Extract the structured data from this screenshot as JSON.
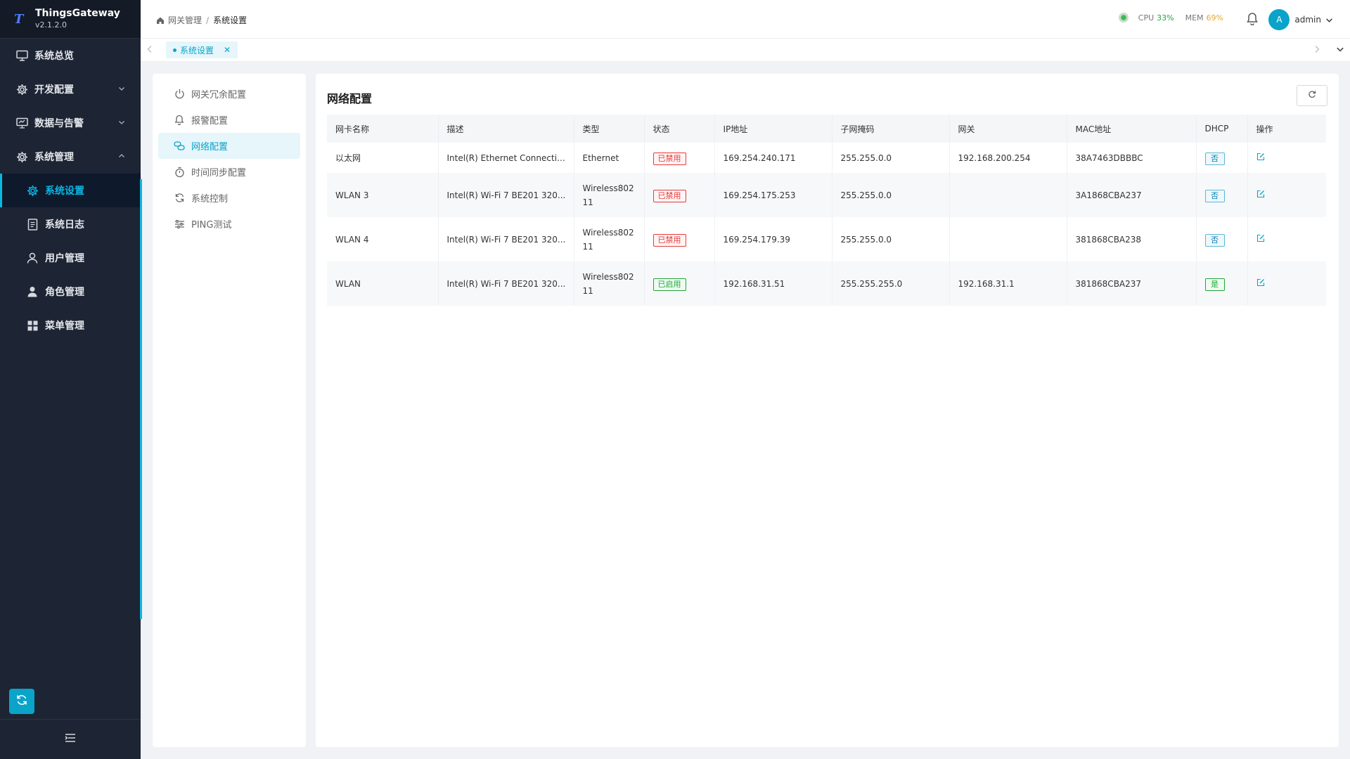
{
  "app": {
    "name": "ThingsGateway",
    "version": "v2.1.2.0"
  },
  "sidebar": {
    "items": [
      {
        "label": "系统总览",
        "icon": "monitor-icon"
      },
      {
        "label": "开发配置",
        "icon": "gear-icon"
      },
      {
        "label": "数据与告警",
        "icon": "monitor-icon"
      },
      {
        "label": "系统管理",
        "icon": "gear-icon"
      },
      {
        "label": "系统设置",
        "icon": "gear-icon"
      },
      {
        "label": "系统日志",
        "icon": "document-icon"
      },
      {
        "label": "用户管理",
        "icon": "user-icon"
      },
      {
        "label": "角色管理",
        "icon": "user-solid-icon"
      },
      {
        "label": "菜单管理",
        "icon": "grid-icon"
      }
    ]
  },
  "header": {
    "breadcrumb": [
      "网关管理",
      "系统设置"
    ],
    "cpu_label": "CPU",
    "cpu_value": "33%",
    "mem_label": "MEM",
    "mem_value": "69%",
    "avatar_letter": "A",
    "username": "admin"
  },
  "tabs": [
    {
      "label": "系统设置"
    }
  ],
  "settings_nav": [
    {
      "label": "网关冗余配置",
      "icon": "power-icon"
    },
    {
      "label": "报警配置",
      "icon": "bell-icon"
    },
    {
      "label": "网络配置",
      "icon": "network-icon"
    },
    {
      "label": "时间同步配置",
      "icon": "timer-icon"
    },
    {
      "label": "系统控制",
      "icon": "sync-icon"
    },
    {
      "label": "PING测试",
      "icon": "sliders-icon"
    }
  ],
  "panel": {
    "title": "网络配置",
    "columns": [
      "网卡名称",
      "描述",
      "类型",
      "状态",
      "IP地址",
      "子网掩码",
      "网关",
      "MAC地址",
      "DHCP",
      "操作"
    ],
    "rows": [
      {
        "name": "以太网",
        "desc": "Intel(R) Ethernet Connectio...",
        "type": "Ethernet",
        "status": "已禁用",
        "ip": "169.254.240.171",
        "mask": "255.255.0.0",
        "gateway": "192.168.200.254",
        "mac": "38A7463DBBBC",
        "dhcp": "否"
      },
      {
        "name": "WLAN 3",
        "desc": "Intel(R) Wi-Fi 7 BE201 320...",
        "type": "Wireless80211",
        "status": "已禁用",
        "ip": "169.254.175.253",
        "mask": "255.255.0.0",
        "gateway": "",
        "mac": "3A1868CBA237",
        "dhcp": "否"
      },
      {
        "name": "WLAN 4",
        "desc": "Intel(R) Wi-Fi 7 BE201 320...",
        "type": "Wireless80211",
        "status": "已禁用",
        "ip": "169.254.179.39",
        "mask": "255.255.0.0",
        "gateway": "",
        "mac": "381868CBA238",
        "dhcp": "否"
      },
      {
        "name": "WLAN",
        "desc": "Intel(R) Wi-Fi 7 BE201 320...",
        "type": "Wireless80211",
        "status": "已启用",
        "ip": "192.168.31.51",
        "mask": "255.255.255.0",
        "gateway": "192.168.31.1",
        "mac": "381868CBA237",
        "dhcp": "是"
      }
    ]
  },
  "colors": {
    "accent": "#0aa3c9",
    "sidebar_bg": "#1d2433",
    "danger": "#e43d3d",
    "success": "#21a63a",
    "warning": "#e9a72a"
  }
}
